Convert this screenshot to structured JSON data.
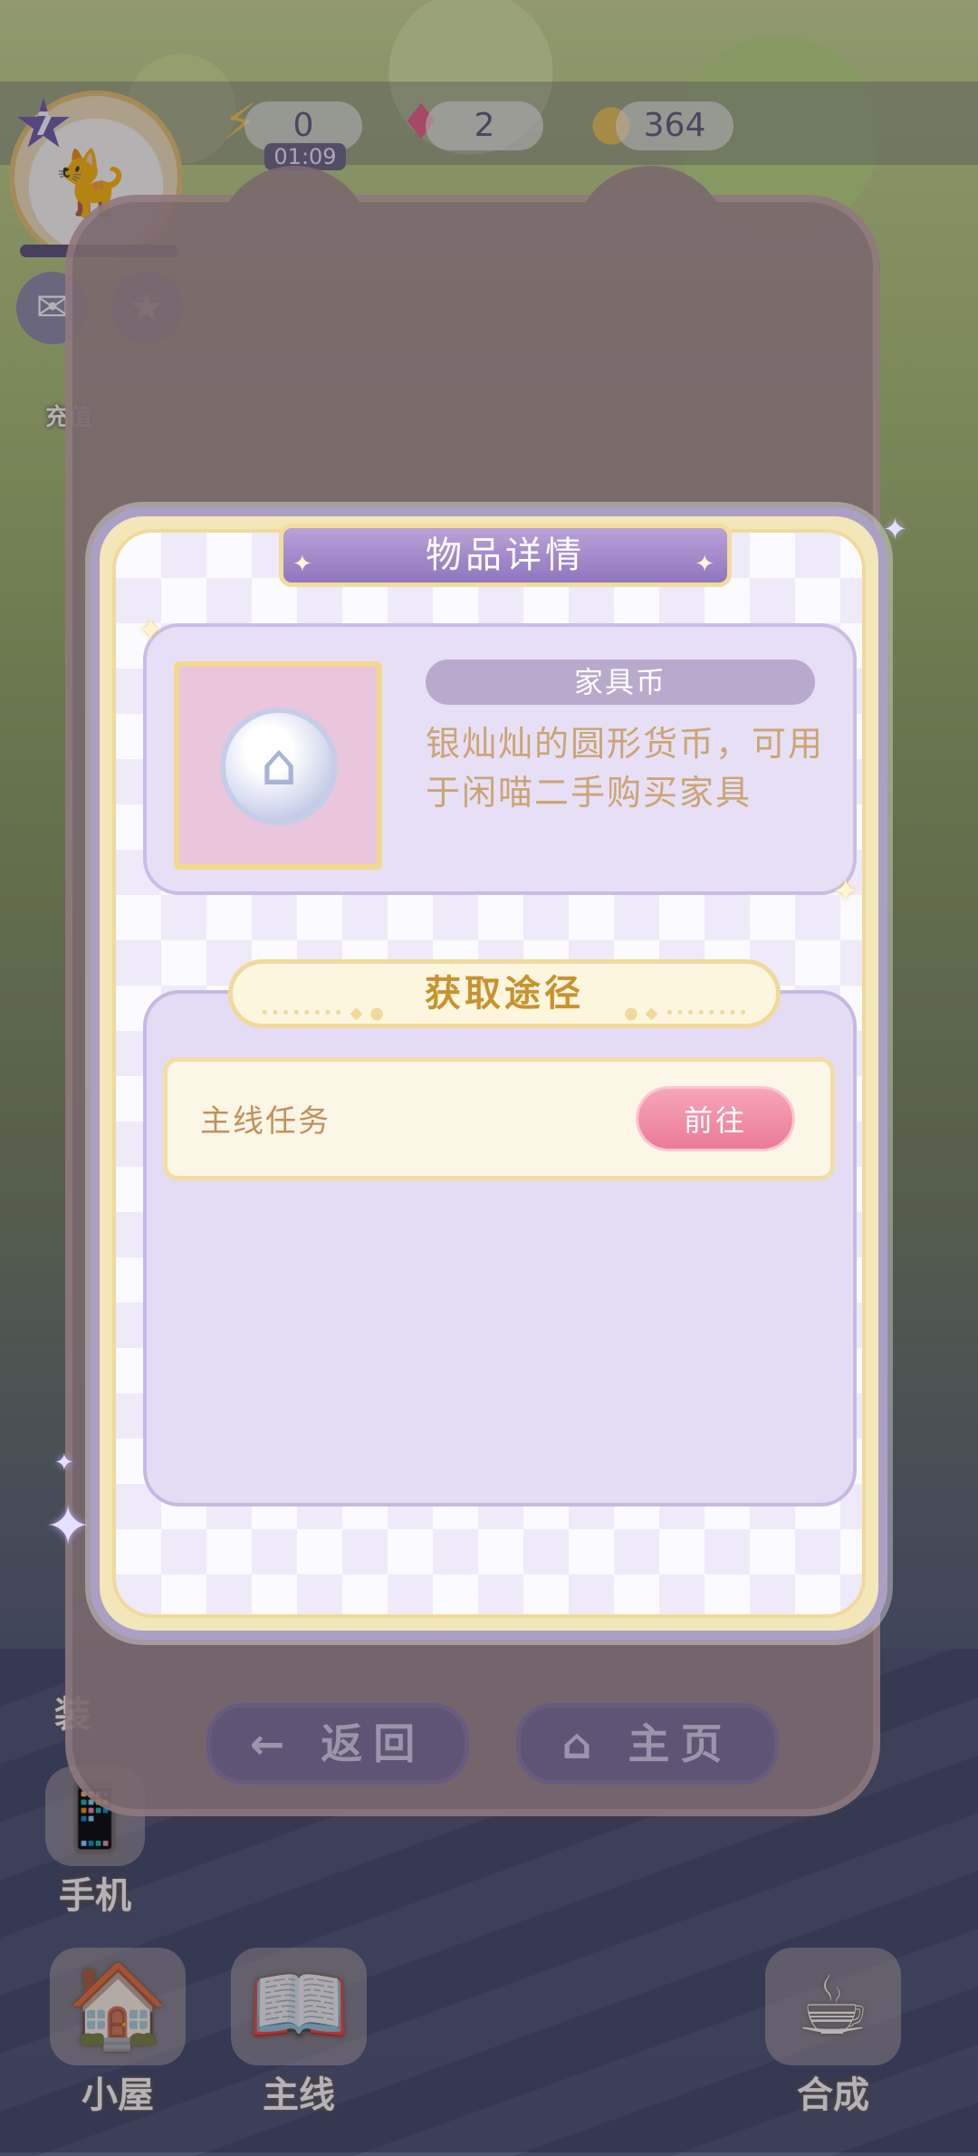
{
  "hud": {
    "level": "7",
    "energy": "0",
    "energy_timer": "01:09",
    "gems": "2",
    "coins": "364",
    "exp_progress": 0.0
  },
  "side": {
    "recharge_label": "充值",
    "decorate_label": "装",
    "phone_label": "手机"
  },
  "bottom_nav": {
    "house_label": "小屋",
    "main_label": "主线",
    "merge_label": "合成"
  },
  "phone_bg": {
    "back_label": "返回",
    "home_label": "主页"
  },
  "modal": {
    "title": "物品详情",
    "item": {
      "name": "家具币",
      "description": "银灿灿的圆形货币，可用于闲喵二手购买家具",
      "icon": "silver-house-coin"
    },
    "source_title": "获取途径",
    "sources": [
      {
        "label": "主线任务",
        "action": "前往"
      }
    ]
  },
  "colors": {
    "modal_border": "#ab9fc6",
    "title_ribbon": "#8f76be",
    "desc_text": "#caa574",
    "go_button": "#ea7b96",
    "source_title_text": "#c9922f"
  }
}
